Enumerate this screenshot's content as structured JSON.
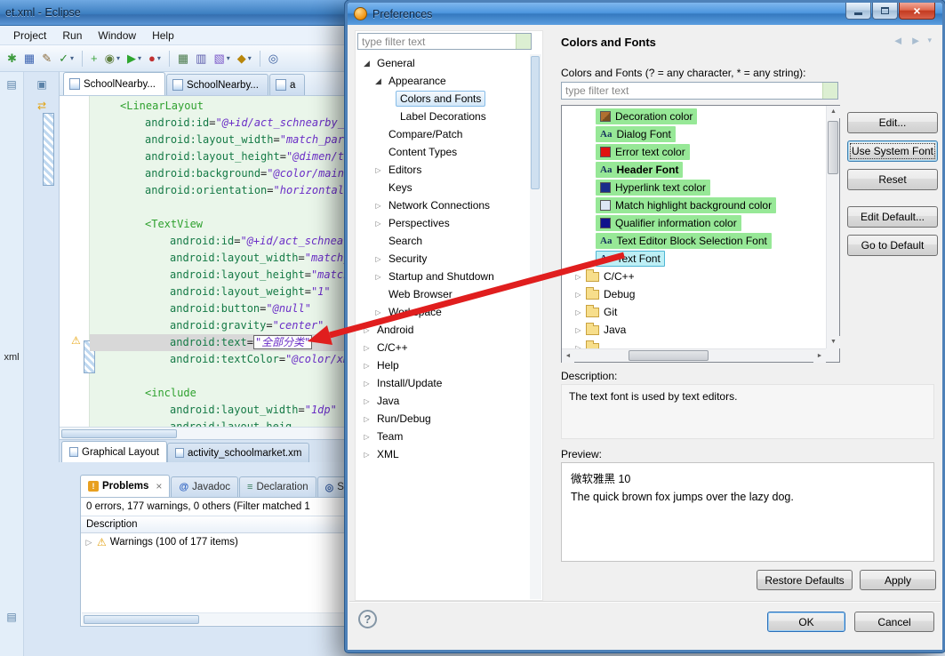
{
  "colors": {
    "title-blue-1": "#6FA8E2",
    "title-blue-2": "#3D7FC1",
    "match-green": "#97E897",
    "select-cyan": "#BDEFF5",
    "select-cyan-border": "#4EB6D4",
    "arrow-red": "#E01E1E",
    "line-highlight": "#D8D8D8",
    "code-bg": "#EAF6EA"
  },
  "eclipse": {
    "title": "et.xml - Eclipse",
    "menus": [
      "Project",
      "Run",
      "Window",
      "Help"
    ],
    "toolbar": [
      {
        "name": "new-wizard-icon",
        "glyph": "✱",
        "color": "#3E9B3E"
      },
      {
        "name": "save-icon",
        "glyph": "▦",
        "color": "#3A62B0"
      },
      {
        "name": "print-icon",
        "glyph": "✎",
        "color": "#8A6A3A"
      },
      {
        "name": "external-tools-icon",
        "glyph": "✓",
        "color": "#2E8B2E",
        "caret": true
      },
      {
        "sep": true
      },
      {
        "name": "new-project-icon",
        "glyph": "+",
        "color": "#3FA53F"
      },
      {
        "name": "debug-icon",
        "glyph": "◉",
        "color": "#5F7F3F",
        "caret": true
      },
      {
        "name": "run-icon",
        "glyph": "▶",
        "color": "#2EA62E",
        "caret": true
      },
      {
        "name": "coverage-icon",
        "glyph": "●",
        "color": "#C03030",
        "caret": true
      },
      {
        "sep": true
      },
      {
        "name": "sdk-manager-icon",
        "glyph": "▦",
        "color": "#4A7A4A"
      },
      {
        "name": "avd-manager-icon",
        "glyph": "▥",
        "color": "#5A5AAA"
      },
      {
        "name": "open-perspective-icon",
        "glyph": "▧",
        "color": "#7A57C8",
        "caret": true
      },
      {
        "name": "new-package-icon",
        "glyph": "◆",
        "color": "#B8860B",
        "caret": true
      },
      {
        "sep": true
      },
      {
        "name": "search-icon",
        "glyph": "◎",
        "color": "#3A5F9F"
      }
    ],
    "rail_label": "xml",
    "editor_tabs": [
      {
        "label": "SchoolNearby...",
        "active": true
      },
      {
        "label": "SchoolNearby...",
        "active": false
      },
      {
        "label": "a",
        "active": false
      }
    ],
    "code_lines": [
      {
        "ind": 1,
        "seg": [
          [
            "t",
            "<LinearLayout"
          ]
        ]
      },
      {
        "ind": 2,
        "seg": [
          [
            "a",
            "android:id"
          ],
          [
            "o",
            "="
          ],
          [
            "v",
            "\"@+id/act_schnearby_ta"
          ]
        ]
      },
      {
        "ind": 2,
        "seg": [
          [
            "a",
            "android:layout_width"
          ],
          [
            "o",
            "="
          ],
          [
            "v",
            "\"match_paren"
          ]
        ]
      },
      {
        "ind": 2,
        "seg": [
          [
            "a",
            "android:layout_height"
          ],
          [
            "o",
            "="
          ],
          [
            "v",
            "\"@dimen/titl"
          ]
        ]
      },
      {
        "ind": 2,
        "seg": [
          [
            "a",
            "android:background"
          ],
          [
            "o",
            "="
          ],
          [
            "v",
            "\"@color/main_"
          ]
        ]
      },
      {
        "ind": 2,
        "seg": [
          [
            "a",
            "android:orientation"
          ],
          [
            "o",
            "="
          ],
          [
            "v",
            "\"horizontal\""
          ],
          [
            "o",
            " >"
          ]
        ]
      },
      {
        "ind": 0,
        "seg": []
      },
      {
        "ind": 2,
        "seg": [
          [
            "t",
            "<TextView"
          ]
        ]
      },
      {
        "ind": 3,
        "seg": [
          [
            "a",
            "android:id"
          ],
          [
            "o",
            "="
          ],
          [
            "v",
            "\"@+id/act_schnearby_"
          ]
        ]
      },
      {
        "ind": 3,
        "seg": [
          [
            "a",
            "android:layout_width"
          ],
          [
            "o",
            "="
          ],
          [
            "v",
            "\"match_par"
          ]
        ]
      },
      {
        "ind": 3,
        "seg": [
          [
            "a",
            "android:layout_height"
          ],
          [
            "o",
            "="
          ],
          [
            "v",
            "\"match_pa"
          ]
        ]
      },
      {
        "ind": 3,
        "seg": [
          [
            "a",
            "android:layout_weight"
          ],
          [
            "o",
            "="
          ],
          [
            "v",
            "\"1\""
          ]
        ]
      },
      {
        "ind": 3,
        "seg": [
          [
            "a",
            "android:button"
          ],
          [
            "o",
            "="
          ],
          [
            "v",
            "\"@null\""
          ]
        ]
      },
      {
        "ind": 3,
        "seg": [
          [
            "a",
            "android:gravity"
          ],
          [
            "o",
            "="
          ],
          [
            "v",
            "\"center\""
          ]
        ]
      },
      {
        "ind": 3,
        "hl": true,
        "seg": [
          [
            "a",
            "android:text"
          ],
          [
            "o",
            "="
          ],
          [
            "vb",
            "\"全部分类\""
          ]
        ]
      },
      {
        "ind": 3,
        "seg": [
          [
            "a",
            "android:textColor"
          ],
          [
            "o",
            "="
          ],
          [
            "v",
            "\"@color/xml_r"
          ]
        ]
      },
      {
        "ind": 0,
        "seg": []
      },
      {
        "ind": 2,
        "seg": [
          [
            "t",
            "<include"
          ]
        ]
      },
      {
        "ind": 3,
        "seg": [
          [
            "a",
            "android:layout_width"
          ],
          [
            "o",
            "="
          ],
          [
            "v",
            "\"1dp\""
          ]
        ]
      },
      {
        "ind": 3,
        "seg": [
          [
            "a",
            "android:layout_heig"
          ]
        ]
      }
    ],
    "bottom_tabs": [
      {
        "label": "Graphical Layout",
        "active": true
      },
      {
        "label": "activity_schoolmarket.xm",
        "active": false
      }
    ],
    "problems": {
      "tabs": [
        {
          "label": "Problems",
          "active": true,
          "closable": true,
          "glyph": "!",
          "glyph_bg": "#E8A020"
        },
        {
          "label": "Javadoc",
          "glyph": "@",
          "glyph_color": "#2A5FC0"
        },
        {
          "label": "Declaration",
          "glyph": "≡",
          "glyph_color": "#3A7F5F"
        },
        {
          "label": "Se",
          "glyph": "◎",
          "glyph_color": "#3A5F9F"
        }
      ],
      "summary": "0 errors, 177 warnings, 0 others (Filter matched 1",
      "column_header": "Description",
      "row": {
        "label": "Warnings (100 of 177 items)"
      }
    }
  },
  "dialog": {
    "title": "Preferences",
    "filter_placeholder": "type filter text",
    "tree": [
      {
        "label": "General",
        "level": 0,
        "state": "expanded"
      },
      {
        "label": "Appearance",
        "level": 1,
        "state": "expanded"
      },
      {
        "label": "Colors and Fonts",
        "level": 2,
        "state": "none",
        "selected": true
      },
      {
        "label": "Label Decorations",
        "level": 2,
        "state": "none"
      },
      {
        "label": "Compare/Patch",
        "level": 1,
        "state": "none"
      },
      {
        "label": "Content Types",
        "level": 1,
        "state": "none"
      },
      {
        "label": "Editors",
        "level": 1,
        "state": "collapsed"
      },
      {
        "label": "Keys",
        "level": 1,
        "state": "none"
      },
      {
        "label": "Network Connections",
        "level": 1,
        "state": "collapsed"
      },
      {
        "label": "Perspectives",
        "level": 1,
        "state": "collapsed"
      },
      {
        "label": "Search",
        "level": 1,
        "state": "none"
      },
      {
        "label": "Security",
        "level": 1,
        "state": "collapsed"
      },
      {
        "label": "Startup and Shutdown",
        "level": 1,
        "state": "collapsed"
      },
      {
        "label": "Web Browser",
        "level": 1,
        "state": "none"
      },
      {
        "label": "Workspace",
        "level": 1,
        "state": "collapsed"
      },
      {
        "label": "Android",
        "level": 0,
        "state": "collapsed"
      },
      {
        "label": "C/C++",
        "level": 0,
        "state": "collapsed"
      },
      {
        "label": "Help",
        "level": 0,
        "state": "collapsed"
      },
      {
        "label": "Install/Update",
        "level": 0,
        "state": "collapsed"
      },
      {
        "label": "Java",
        "level": 0,
        "state": "collapsed"
      },
      {
        "label": "Run/Debug",
        "level": 0,
        "state": "collapsed"
      },
      {
        "label": "Team",
        "level": 0,
        "state": "collapsed"
      },
      {
        "label": "XML",
        "level": 0,
        "state": "collapsed"
      }
    ],
    "right": {
      "header": "Colors and Fonts",
      "filter_hint_label": "Colors and Fonts (? = any character, * = any string):",
      "filter_placeholder": "type filter text",
      "list": [
        {
          "type": "color",
          "chip": "#B07030",
          "chip2": "#7A4E1F",
          "label": "Decoration color",
          "match": true
        },
        {
          "type": "font",
          "label": "Dialog Font",
          "match": true
        },
        {
          "type": "color",
          "chip": "#E01010",
          "label": "Error text color",
          "match": true
        },
        {
          "type": "font",
          "label": "Header Font",
          "bold": true,
          "match": true
        },
        {
          "type": "color",
          "chip": "#1A2E8A",
          "label": "Hyperlink text color",
          "match": true
        },
        {
          "type": "color",
          "chip": "#DCE6F5",
          "label": "Match highlight background color",
          "match": true
        },
        {
          "type": "color",
          "chip": "#10128C",
          "label": "Qualifier information color",
          "match": true
        },
        {
          "type": "font",
          "label": "Text Editor Block Selection Font",
          "match": true
        },
        {
          "type": "font",
          "label": "Text Font",
          "match": true,
          "selected": true
        },
        {
          "type": "folder",
          "label": "C/C++"
        },
        {
          "type": "folder",
          "label": "Debug"
        },
        {
          "type": "folder",
          "label": "Git"
        },
        {
          "type": "folder",
          "label": "Java"
        },
        {
          "type": "folder",
          "label": ""
        }
      ],
      "buttons": [
        "Edit...",
        "Use System Font",
        "Reset",
        "Edit Default...",
        "Go to Default"
      ],
      "description_label": "Description:",
      "description_text": "The text font is used by text editors.",
      "preview_label": "Preview:",
      "preview_line1": "微软雅黑 10",
      "preview_line2": "The quick brown fox jumps over the lazy dog.",
      "restore_defaults": "Restore Defaults",
      "apply": "Apply"
    },
    "ok": "OK",
    "cancel": "Cancel"
  }
}
